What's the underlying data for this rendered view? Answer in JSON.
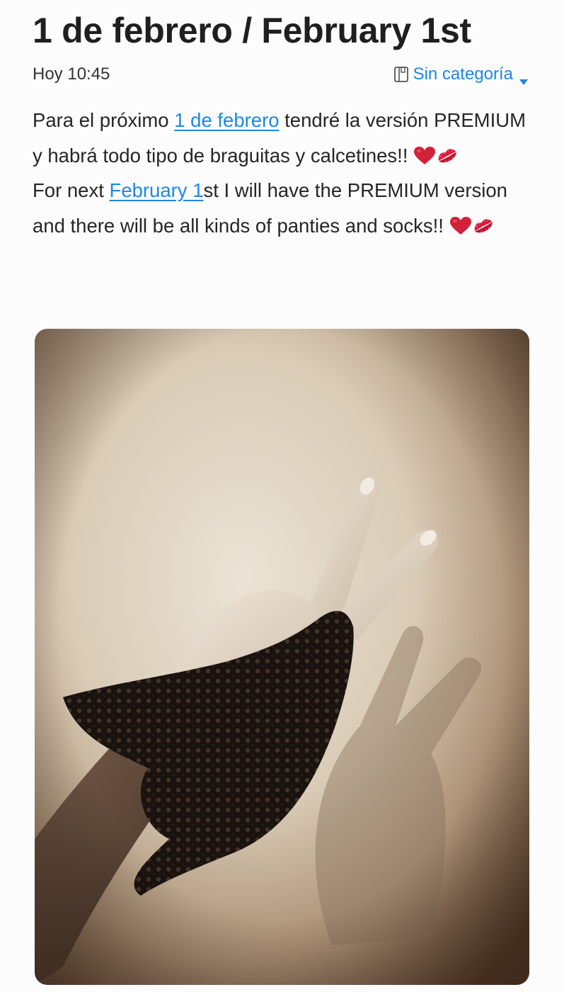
{
  "post": {
    "title": "1 de febrero / February 1st",
    "time": "Hoy 10:45",
    "category": {
      "label": "Sin categoría",
      "icon": "notebook-icon",
      "caret": "caret-down-icon",
      "color": "#1e88e5"
    },
    "paragraph_es": {
      "before": "Para el próximo ",
      "link": "1 de febrero",
      "after": " tendré la versión PREMIUM y habrá todo tipo de braguitas y calcetines!! ",
      "emojis": [
        "heart-emoji",
        "kiss-mark-emoji"
      ]
    },
    "paragraph_en": {
      "before": "For next ",
      "link": "February 1",
      "after": "st I will have the PREMIUM version and there will be all kinds of panties and socks!! ",
      "emojis": [
        "heart-emoji",
        "kiss-mark-emoji"
      ]
    },
    "image": {
      "subject": "sepia photo of a hand making a peace sign with black lace fabric",
      "tone": "sepia"
    }
  },
  "colors": {
    "text": "#262626",
    "link": "#1e88e5",
    "background": "#fcfcfc",
    "heart": "#d3213a",
    "kiss": "#d81b3c"
  }
}
